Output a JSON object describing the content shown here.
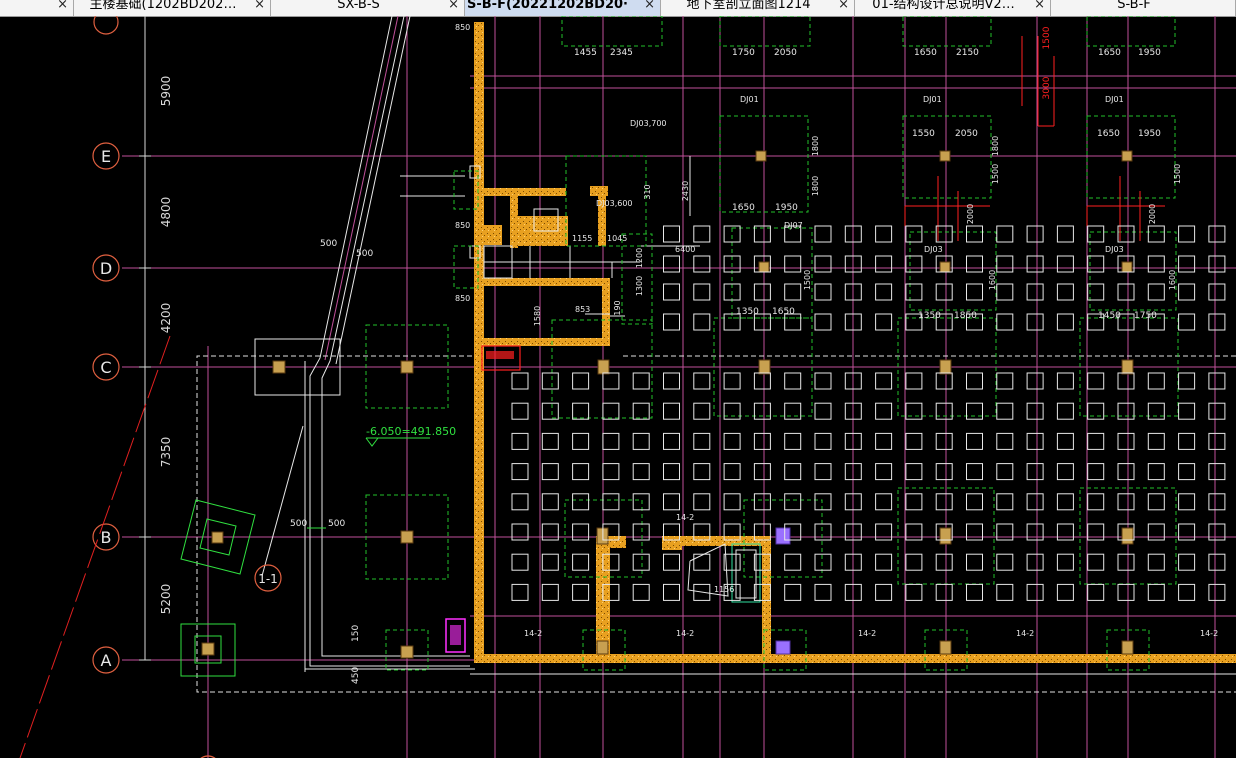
{
  "tabs": [
    {
      "label": "",
      "close": "×",
      "active": false
    },
    {
      "label": "主楼基础(1202BD202…",
      "close": "×",
      "active": false
    },
    {
      "label": "SX-B-S",
      "close": "×",
      "active": false
    },
    {
      "label": "S-B-F(20221202BD20·",
      "close": "×",
      "active": true
    },
    {
      "label": "地下室剖立面图1214",
      "close": "×",
      "active": false
    },
    {
      "label": "01-结构设计总说明V2…",
      "close": "×",
      "active": false
    },
    {
      "label": "S-B-F",
      "close": "",
      "active": false
    }
  ],
  "drawing": {
    "colors": {
      "background": "#000000",
      "axis": "#c0509a",
      "foundation": "#f0a020",
      "dashed": "#22c02a",
      "wall": "#e8e8e8",
      "annotation": "#ff2020",
      "dim": "#d8d8d8"
    },
    "grid_bubbles": [
      "E",
      "D",
      "C",
      "B",
      "A"
    ],
    "left_dims": [
      "5900",
      "4800",
      "4200",
      "7350",
      "5200"
    ],
    "section_mark": "1-1",
    "elevation": "-6.050=491.850",
    "left_labels": {
      "slope_a": "500",
      "slope_b": "500",
      "ramp_left": "500",
      "ramp_right": "500",
      "bottom_a": "150",
      "bottom_b": "450",
      "pit": "850"
    },
    "top_dims": [
      "1455",
      "2345",
      "1750",
      "2050",
      "1650",
      "2150",
      "1650",
      "1950"
    ],
    "dj_labels": [
      "DJ01",
      "DJ01",
      "DJ01",
      "DJ03",
      "DJ03",
      "DJ07"
    ],
    "mid_dims": [
      "1550",
      "2050",
      "1650",
      "1950",
      "1650",
      "1950",
      "1350",
      "1650",
      "1350",
      "1850",
      "1450",
      "1750"
    ],
    "vert_dims": [
      "1800",
      "1800",
      "1500",
      "1800",
      "1600",
      "1600",
      "1500",
      "1500",
      "2000",
      "2000"
    ],
    "red_dims": [
      "3000",
      "1500"
    ],
    "core_labels": [
      "DJ03,600",
      "DJ03,700",
      "1155",
      "1045",
      "6400",
      "2430",
      "310",
      "853",
      "190",
      "1200",
      "1580",
      "1300"
    ],
    "sump_labels": [
      "1156",
      "14-2"
    ],
    "bottom_tags": [
      "14-2",
      "14-2",
      "14-2",
      "14-2",
      "14-2"
    ]
  }
}
